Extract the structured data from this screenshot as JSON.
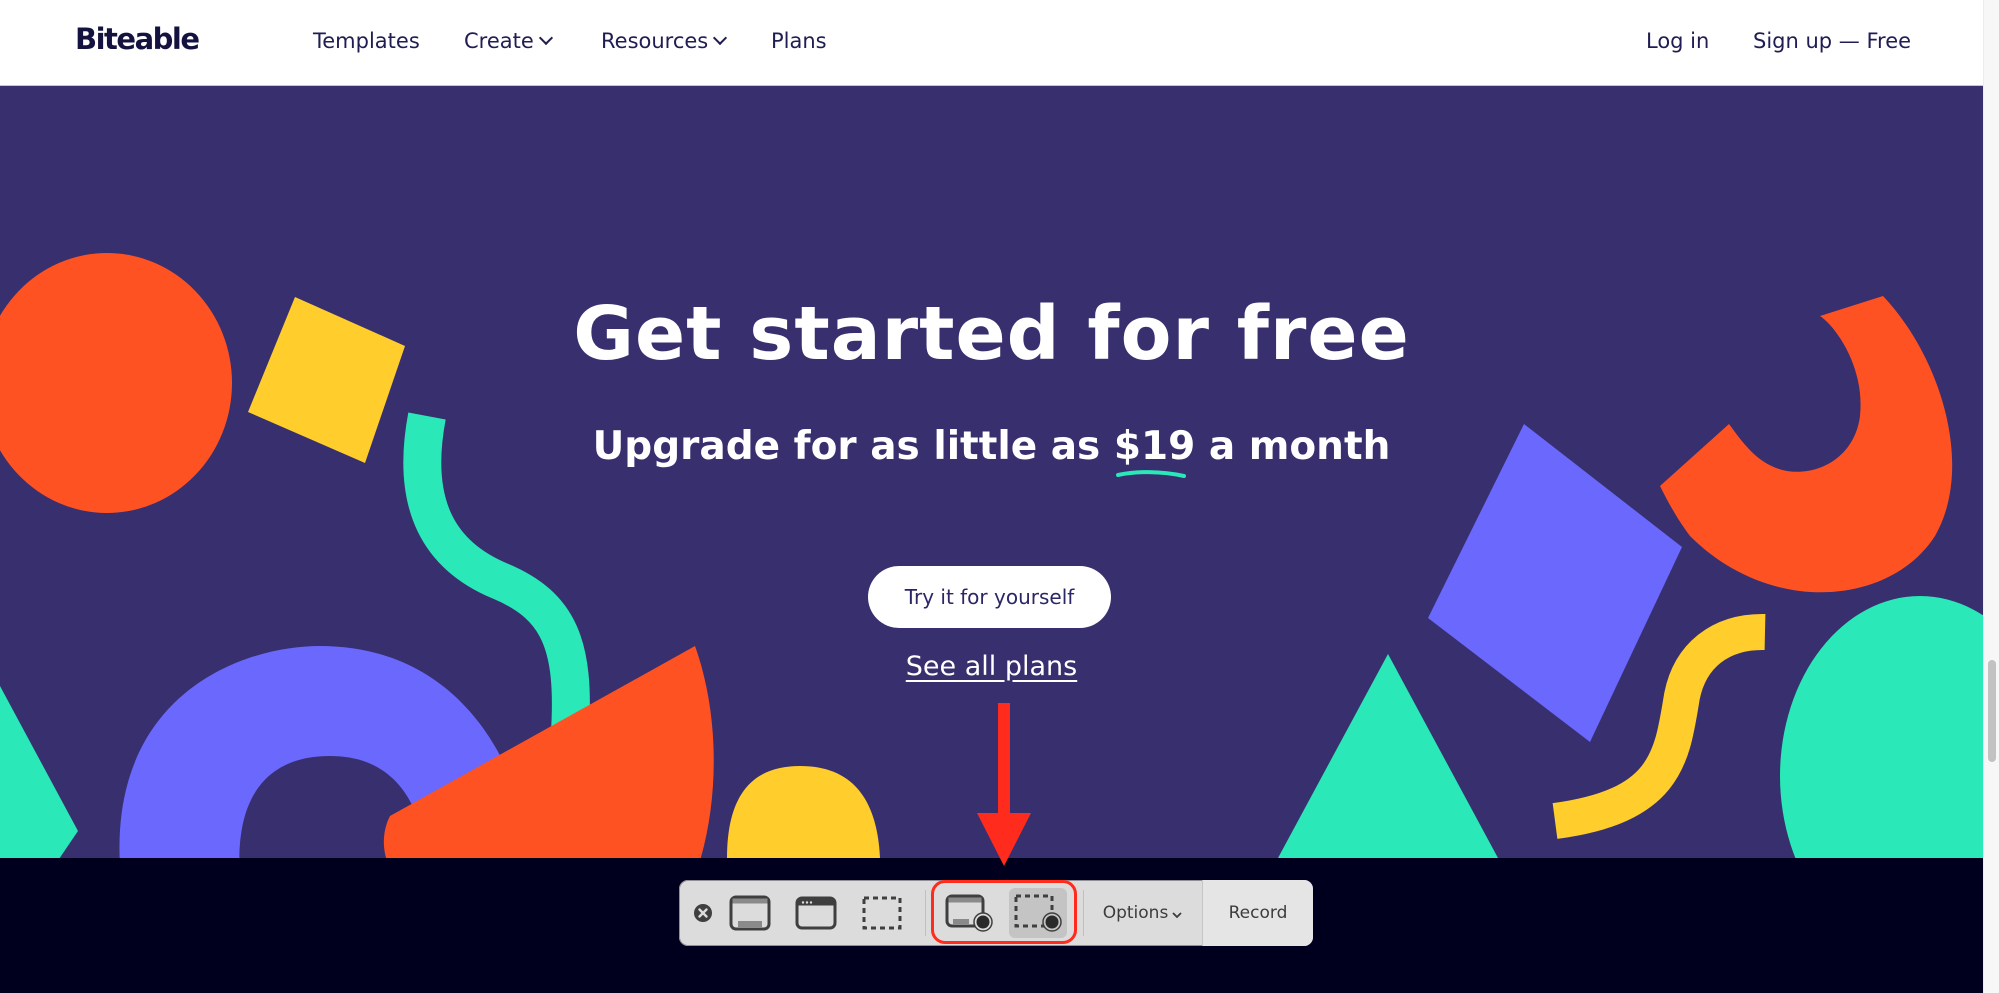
{
  "nav": {
    "logo": "Biteable",
    "items": [
      {
        "label": "Templates",
        "has_dropdown": false
      },
      {
        "label": "Create",
        "has_dropdown": true
      },
      {
        "label": "Resources",
        "has_dropdown": true
      },
      {
        "label": "Plans",
        "has_dropdown": false
      }
    ],
    "login": "Log in",
    "signup": "Sign up — Free"
  },
  "hero": {
    "headline": "Get started for free",
    "sub_before": "Upgrade for as little as ",
    "sub_price": "$19",
    "sub_after": " a month",
    "cta": "Try it for yourself",
    "plans_link": "See all plans",
    "colors": {
      "background": "#372f6e",
      "orange": "#ff5222",
      "yellow": "#ffcd2c",
      "teal": "#2ae8b8",
      "purple": "#6a68fd",
      "underline": "#2ae8b8"
    }
  },
  "annotation": {
    "arrow_color": "#ff2b1c",
    "highlight_color": "#ff2b1c"
  },
  "screenshot_toolbar": {
    "buttons": [
      {
        "name": "close",
        "icon": "close-circle-icon"
      },
      {
        "name": "capture-entire-screen",
        "icon": "screen-icon"
      },
      {
        "name": "capture-selected-window",
        "icon": "window-icon"
      },
      {
        "name": "capture-selected-portion",
        "icon": "dashed-rect-icon"
      },
      {
        "name": "record-entire-screen",
        "icon": "screen-record-icon"
      },
      {
        "name": "record-selected-portion",
        "icon": "dashed-rect-record-icon",
        "selected": true
      }
    ],
    "options_label": "Options",
    "record_label": "Record"
  },
  "scrollbar": {
    "position_fraction": 0.72
  }
}
